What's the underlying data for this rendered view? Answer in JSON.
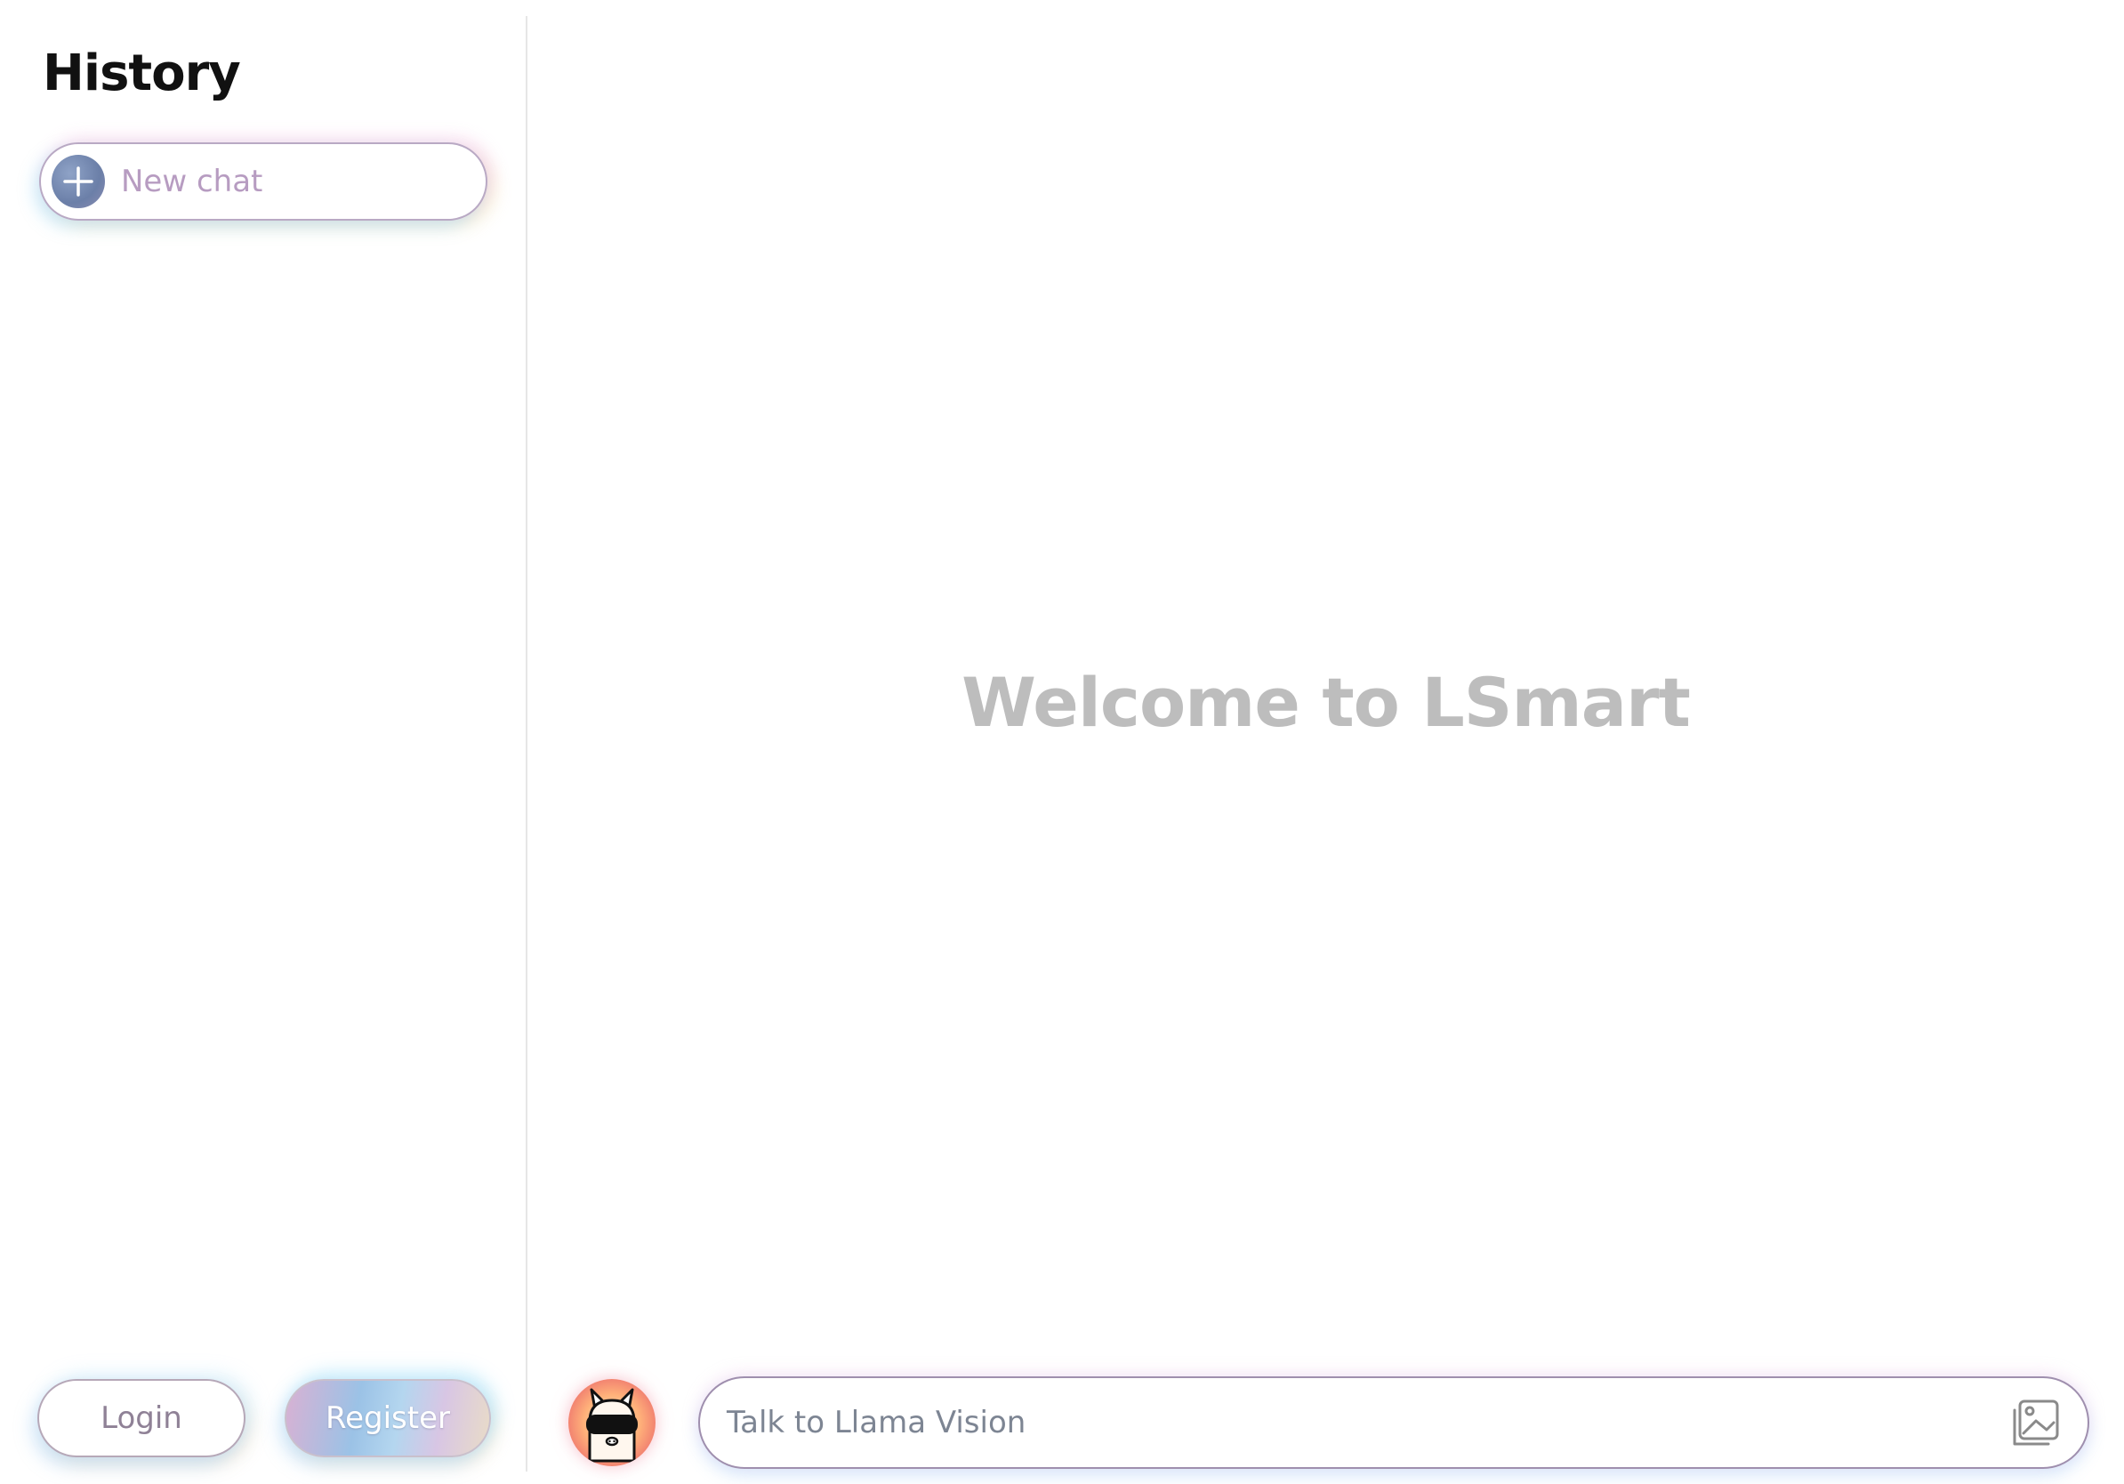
{
  "sidebar": {
    "title": "History",
    "new_chat_label": "New chat",
    "login_label": "Login",
    "register_label": "Register"
  },
  "main": {
    "welcome_text": "Welcome to LSmart",
    "input_placeholder": "Talk to Llama Vision"
  },
  "icons": {
    "new_chat": "plus-icon",
    "avatar": "llama-avatar-icon",
    "attach_image": "image-icon"
  },
  "colors": {
    "title": "#111111",
    "welcome": "#bdbdbd",
    "new_chat_text": "#b79cc1",
    "placeholder": "#7d8593"
  }
}
